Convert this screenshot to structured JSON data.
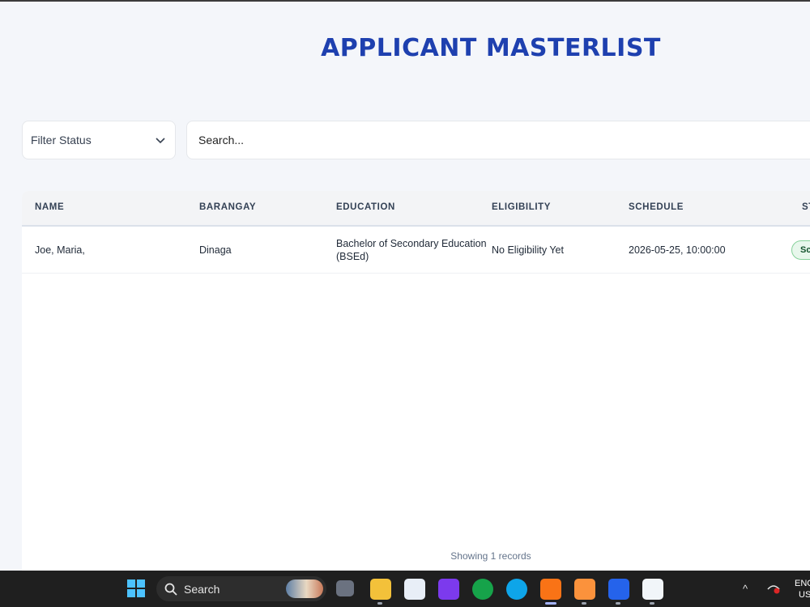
{
  "page": {
    "title": "APPLICANT MASTERLIST"
  },
  "filters": {
    "status_label": "Filter Status",
    "search_placeholder": "Search..."
  },
  "table": {
    "columns": [
      "NAME",
      "BARANGAY",
      "EDUCATION",
      "ELIGIBILITY",
      "SCHEDULE",
      "ST"
    ],
    "rows": [
      {
        "name": "Joe, Maria,",
        "barangay": "Dinaga",
        "education": "Bachelor of Secondary Education (BSEd)",
        "eligibility": "No Eligibility Yet",
        "schedule": "2026-05-25, 10:00:00",
        "status": "Sch"
      }
    ]
  },
  "footer": {
    "records_text": "Showing 1 records"
  },
  "taskbar": {
    "search_label": "Search",
    "lang_line1": "ENG",
    "lang_line2": "US",
    "apps": [
      "start-icon",
      "task-view-icon",
      "file-explorer-icon",
      "microsoft-store-icon",
      "app-icon",
      "xbox-icon",
      "edge-icon",
      "brave-icon",
      "xampp-icon",
      "vscode-icon",
      "snipping-tool-icon"
    ]
  },
  "colors": {
    "title": "#1e40af",
    "badge_border": "#86d19a",
    "taskbar": "#1f1f1f"
  }
}
